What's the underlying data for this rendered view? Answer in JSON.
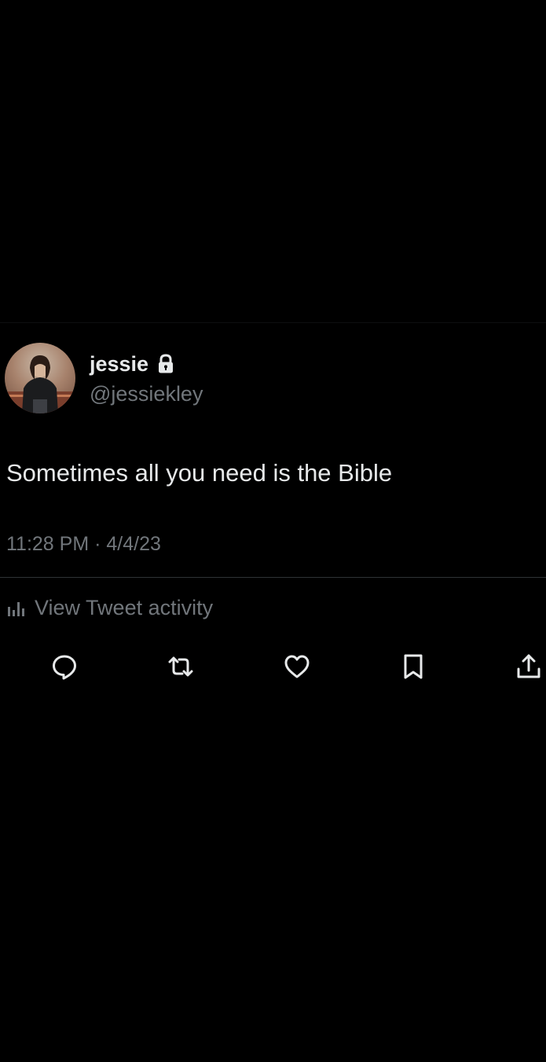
{
  "tweet": {
    "author": {
      "display_name": "jessie",
      "handle": "@jessiekley",
      "protected_icon": "lock-icon",
      "avatar_icon": "profile-photo"
    },
    "text": "Sometimes all you need is the Bible",
    "timestamp": "11:28 PM · 4/4/23",
    "activity": {
      "icon": "bar-chart-icon",
      "label": "View Tweet activity"
    },
    "actions": [
      {
        "name": "reply",
        "icon": "speech-bubble-icon"
      },
      {
        "name": "retweet",
        "icon": "retweet-icon"
      },
      {
        "name": "like",
        "icon": "heart-icon"
      },
      {
        "name": "bookmark",
        "icon": "bookmark-icon"
      },
      {
        "name": "share",
        "icon": "share-icon"
      }
    ]
  },
  "colors": {
    "background": "#000000",
    "primary_text": "#e7e9ea",
    "secondary_text": "#71767b",
    "divider": "#2f3336"
  }
}
